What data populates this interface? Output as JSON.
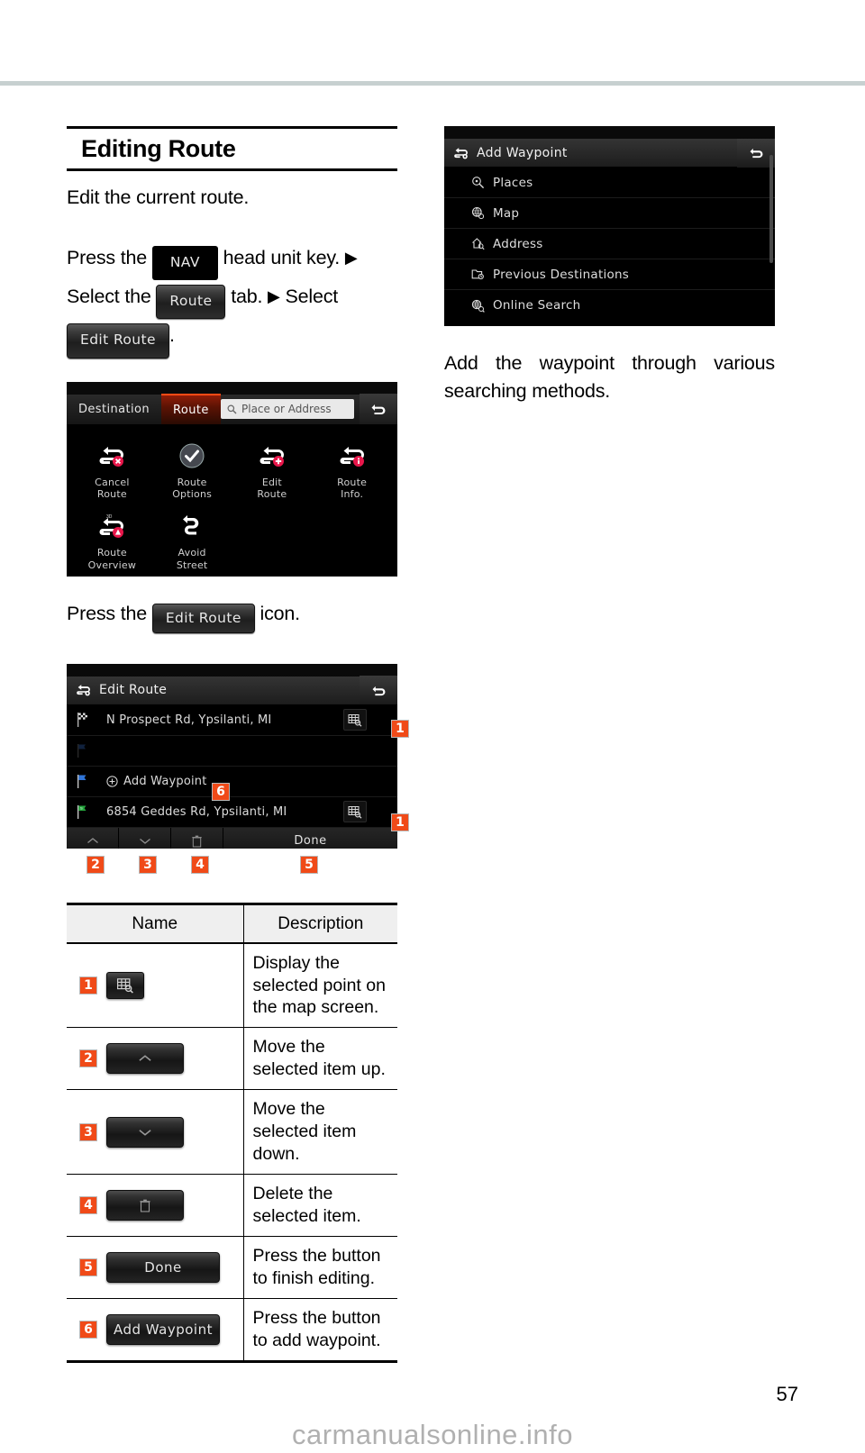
{
  "document": {
    "page_number": "57",
    "watermark": "carmanualsonline.info"
  },
  "left_column": {
    "heading": "Editing Route",
    "intro": "Edit the current route.",
    "steps_line": {
      "part1": "Press the",
      "chip_nav": "NAV",
      "part2": "head unit key.",
      "arrow": "▶",
      "part3": "Select  the",
      "chip_route": "Route",
      "part4": "tab.",
      "part5": "Select",
      "chip_edit_route": "Edit Route",
      "period": "."
    },
    "press_icon_line": {
      "before": "Press the",
      "chip": "Edit Route",
      "after": "icon."
    }
  },
  "screenshot_route_menu": {
    "tabs": [
      {
        "label": "Destination",
        "active": false
      },
      {
        "label": "Route",
        "active": true
      }
    ],
    "search_placeholder": "Place or Address",
    "search_icon": "search-icon",
    "back_icon": "back-arrow-icon",
    "items": [
      {
        "label": "Cancel\nRoute",
        "icon": "cancel-route-icon"
      },
      {
        "label": "Route\nOptions",
        "icon": "route-options-icon"
      },
      {
        "label": "Edit\nRoute",
        "icon": "edit-route-icon"
      },
      {
        "label": "Route\nInfo.",
        "icon": "route-info-icon"
      },
      {
        "label": "Route\nOverview",
        "icon": "route-overview-icon"
      },
      {
        "label": "Avoid\nStreet",
        "icon": "avoid-street-icon"
      }
    ]
  },
  "screenshot_edit_route": {
    "title": "Edit Route",
    "title_icon": "edit-route-icon",
    "back_icon": "back-arrow-icon",
    "rows": [
      {
        "text": "N Prospect Rd, Ypsilanti, MI",
        "flag": "checkered-flag-icon",
        "map_button": true,
        "badge": "1"
      },
      {
        "text": "",
        "flag": "blue-flag-dim-icon",
        "map_button": false,
        "badge": ""
      },
      {
        "text": "Add Waypoint",
        "flag": "blue-flag-icon",
        "map_button": false,
        "badge": "6",
        "prefix_icon": "plus-circle-icon"
      },
      {
        "text": "6854 Geddes Rd, Ypsilanti, MI",
        "flag": "green-flag-icon",
        "map_button": true,
        "badge": "1"
      }
    ],
    "toolbar": {
      "up": {
        "icon": "chevron-up-icon",
        "badge": "2"
      },
      "down": {
        "icon": "chevron-down-icon",
        "badge": "3"
      },
      "delete": {
        "icon": "trash-icon",
        "badge": "4"
      },
      "done": {
        "label": "Done",
        "badge": "5"
      }
    }
  },
  "screenshot_add_waypoint": {
    "title": "Add Waypoint",
    "title_icon": "add-waypoint-icon",
    "back_icon": "back-arrow-icon",
    "items": [
      {
        "label": "Places",
        "icon": "places-search-icon"
      },
      {
        "label": "Map",
        "icon": "map-search-icon"
      },
      {
        "label": "Address",
        "icon": "address-search-icon"
      },
      {
        "label": "Previous Destinations",
        "icon": "previous-destinations-icon"
      },
      {
        "label": "Online Search",
        "icon": "online-search-icon"
      }
    ]
  },
  "right_column": {
    "paragraph": "Add the waypoint through various searching methods."
  },
  "table": {
    "headers": {
      "name": "Name",
      "description": "Description"
    },
    "rows": [
      {
        "badge": "1",
        "button_type": "map-icon",
        "button_label": "",
        "description": "Display the selected point on the map screen."
      },
      {
        "badge": "2",
        "button_type": "chevron-up",
        "button_label": "",
        "description": "Move the selected item up."
      },
      {
        "badge": "3",
        "button_type": "chevron-down",
        "button_label": "",
        "description": "Move the selected item down."
      },
      {
        "badge": "4",
        "button_type": "trash",
        "button_label": "",
        "description": "Delete the selected item."
      },
      {
        "badge": "5",
        "button_type": "text",
        "button_label": "Done",
        "description": "Press the button to finish editing."
      },
      {
        "badge": "6",
        "button_type": "text",
        "button_label": "Add Waypoint",
        "description": "Press the button to add waypoint."
      }
    ]
  },
  "colors": {
    "accent_orange": "#f04a18",
    "rule_gray": "#c7d0d0",
    "tab_active_red": "#8f1d08"
  }
}
